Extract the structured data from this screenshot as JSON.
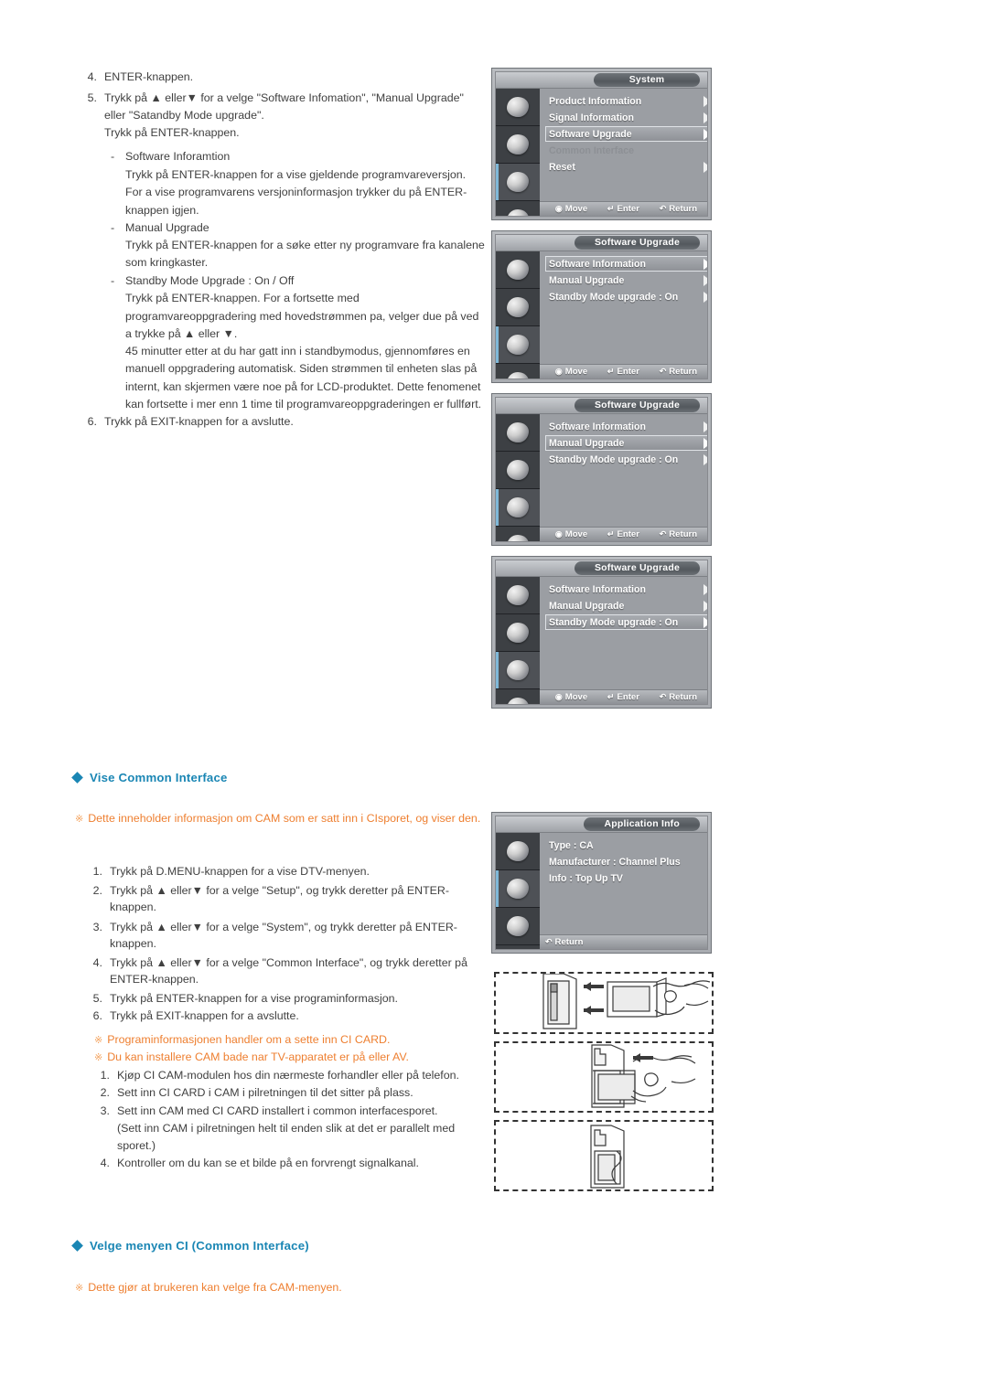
{
  "document": {
    "language": "no",
    "accent_blue": "#1a86b4",
    "accent_orange": "#ee7f30"
  },
  "instructions_software_upgrade": {
    "items": [
      {
        "num": "4.",
        "lines": [
          "ENTER-knappen."
        ]
      },
      {
        "num": "5.",
        "lines": [
          "Trykk på ▲ eller▼ for a velge \"Software Infomation\", \"Manual Upgrade\"",
          "eller \"Satandby Mode upgrade\".",
          "Trykk på ENTER-knappen."
        ]
      }
    ],
    "sub_items": [
      {
        "dash": "-",
        "title": "Software Inforamtion",
        "lines": [
          "Trykk på ENTER-knappen for a vise gjeldende programvareversjon.",
          "For a vise programvarens versjoninformasjon trykker du på ENTER-",
          "knappen igjen."
        ]
      },
      {
        "dash": "-",
        "title": "Manual Upgrade",
        "lines": [
          "Trykk på ENTER-knappen for a søke etter ny programvare fra kanalene",
          "som kringkaster."
        ]
      },
      {
        "dash": "-",
        "title": "Standby Mode Upgrade : On / Off",
        "lines": [
          "Trykk på ENTER-knappen. For a fortsette med",
          "programvareoppgradering med hovedstrømmen pa, velger due på ved",
          "a trykke på ▲ eller ▼.",
          "45 minutter etter at du har gatt inn i standbymodus, gjennomføres en",
          "manuell oppgradering automatisk. Siden strømmen til enheten slas på",
          "internt, kan skjermen være noe på for LCD-produktet. Dette fenomenet",
          "kan fortsette i mer enn 1 time til programvareoppgraderingen er fullført."
        ]
      }
    ],
    "final": {
      "num": "6.",
      "text": "Trykk på EXIT-knappen for a avslutte."
    }
  },
  "osd_panels": [
    {
      "id": "system-menu",
      "title": "System",
      "rows": [
        {
          "label": "Product Information",
          "arrow": true,
          "state": "normal"
        },
        {
          "label": "Signal Information",
          "arrow": true,
          "state": "normal"
        },
        {
          "label": "Software Upgrade",
          "arrow": true,
          "state": "highlight"
        },
        {
          "label": "Common Interface",
          "arrow": false,
          "state": "dim"
        },
        {
          "label": "Reset",
          "arrow": true,
          "state": "normal"
        }
      ],
      "footer": [
        {
          "glyph": "↕",
          "label": "Move"
        },
        {
          "glyph": "↵",
          "label": "Enter"
        },
        {
          "glyph": "↩",
          "label": "Return"
        }
      ]
    },
    {
      "id": "software-upgrade-1",
      "title": "Software Upgrade",
      "rows": [
        {
          "label": "Software Information",
          "arrow": true,
          "state": "highlight"
        },
        {
          "label": "Manual Upgrade",
          "arrow": true,
          "state": "normal"
        },
        {
          "label": "Standby Mode upgrade : On",
          "arrow": true,
          "state": "normal"
        }
      ],
      "footer": [
        {
          "glyph": "↕",
          "label": "Move"
        },
        {
          "glyph": "↵",
          "label": "Enter"
        },
        {
          "glyph": "↩",
          "label": "Return"
        }
      ]
    },
    {
      "id": "software-upgrade-2",
      "title": "Software Upgrade",
      "rows": [
        {
          "label": "Software Information",
          "arrow": true,
          "state": "normal"
        },
        {
          "label": "Manual Upgrade",
          "arrow": true,
          "state": "highlight"
        },
        {
          "label": "Standby Mode upgrade : On",
          "arrow": true,
          "state": "normal"
        }
      ],
      "footer": [
        {
          "glyph": "↕",
          "label": "Move"
        },
        {
          "glyph": "↵",
          "label": "Enter"
        },
        {
          "glyph": "↩",
          "label": "Return"
        }
      ]
    },
    {
      "id": "software-upgrade-3",
      "title": "Software Upgrade",
      "rows": [
        {
          "label": "Software Information",
          "arrow": true,
          "state": "normal"
        },
        {
          "label": "Manual Upgrade",
          "arrow": true,
          "state": "normal"
        },
        {
          "label": "Standby Mode upgrade : On",
          "arrow": true,
          "state": "highlight"
        }
      ],
      "footer": [
        {
          "glyph": "↕",
          "label": "Move"
        },
        {
          "glyph": "↵",
          "label": "Enter"
        },
        {
          "glyph": "↩",
          "label": "Return"
        }
      ]
    },
    {
      "id": "application-info",
      "title": "Application Info",
      "rows": [
        {
          "label": "Type : CA",
          "arrow": false,
          "state": "normal"
        },
        {
          "label": "Manufacturer : Channel Plus",
          "arrow": false,
          "state": "normal"
        },
        {
          "label": "Info : Top Up TV",
          "arrow": false,
          "state": "normal"
        }
      ],
      "footer": [
        {
          "glyph": "↩",
          "label": "Return"
        }
      ]
    }
  ],
  "section_common_interface": {
    "heading": "Vise Common Interface",
    "note": "Dette inneholder informasjon om CAM som er satt inn i CIsporet, og viser den.",
    "steps": [
      {
        "num": "1.",
        "lines": [
          "Trykk på D.MENU-knappen for a vise DTV-menyen."
        ]
      },
      {
        "num": "2.",
        "lines": [
          "Trykk på ▲ eller▼ for a velge \"Setup\", og trykk deretter på ENTER-",
          "knappen."
        ]
      },
      {
        "num": "3.",
        "lines": [
          "Trykk på ▲ eller▼ for a velge \"System\", og trykk deretter på ENTER-",
          "knappen."
        ]
      },
      {
        "num": "4.",
        "lines": [
          "Trykk på ▲ eller▼ for a velge \"Common Interface\", og trykk deretter på",
          "ENTER-knappen."
        ]
      },
      {
        "num": "5.",
        "lines": [
          "Trykk på ENTER-knappen for a vise programinformasjon."
        ]
      },
      {
        "num": "6.",
        "lines": [
          "Trykk på EXIT-knappen for a avslutte."
        ]
      }
    ],
    "notes2": [
      "Programinformasjonen handler om a sette inn CI CARD.",
      "Du kan installere CAM bade nar TV-apparatet er på eller AV."
    ],
    "cam_steps": [
      {
        "num": "1.",
        "lines": [
          "Kjøp CI CAM-modulen hos din nærmeste forhandler eller på telefon."
        ]
      },
      {
        "num": "2.",
        "lines": [
          "Sett inn CI CARD i CAM i pilretningen til det sitter på plass."
        ]
      },
      {
        "num": "3.",
        "lines": [
          "Sett inn CAM med CI CARD installert i common interfacesporet.",
          "(Sett inn CAM i pilretningen helt til enden slik at det er parallelt med",
          "sporet.)"
        ]
      },
      {
        "num": "4.",
        "lines": [
          "Kontroller om du kan se et bilde på en forvrengt signalkanal."
        ]
      }
    ]
  },
  "section_ci_menu": {
    "heading": "Velge menyen CI (Common Interface)",
    "note": "Dette gjør at brukeren kan velge fra CAM-menyen."
  },
  "illustrations": [
    {
      "id": "cam-insert-step1",
      "caption": ""
    },
    {
      "id": "cam-insert-step2",
      "caption": ""
    },
    {
      "id": "cam-insert-step3",
      "caption": ""
    }
  ]
}
